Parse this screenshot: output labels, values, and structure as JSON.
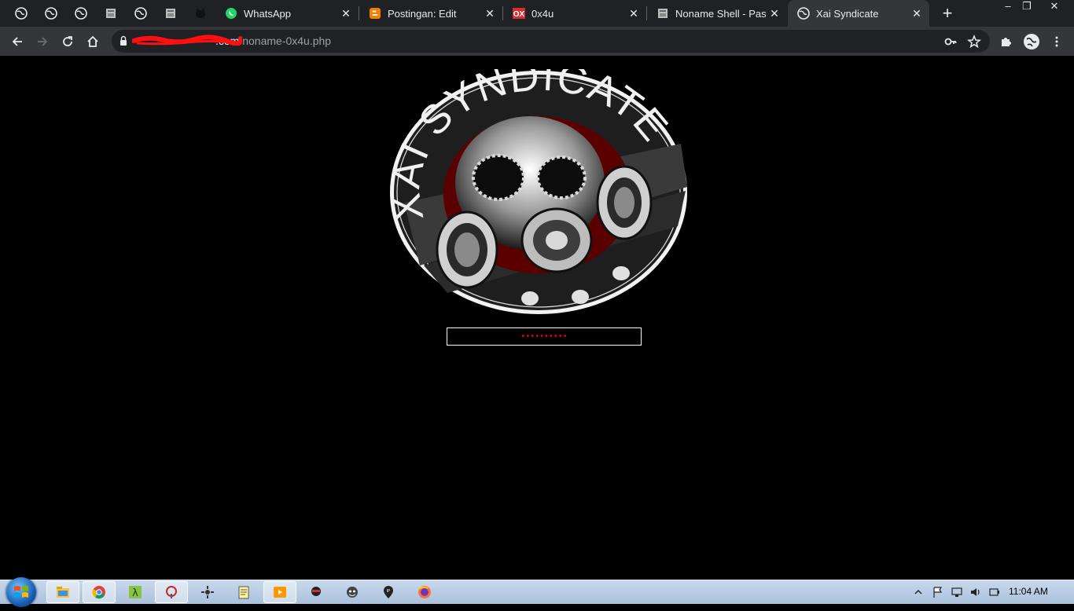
{
  "browser": {
    "pinned_tabs": [
      "globe-icon",
      "globe-icon",
      "globe-icon",
      "document-icon",
      "globe-icon",
      "document-icon",
      "cat-icon"
    ],
    "tabs": [
      {
        "title": "WhatsApp",
        "icon": "whatsapp-icon",
        "active": false
      },
      {
        "title": "Postingan: Edit",
        "icon": "blogger-icon",
        "active": false
      },
      {
        "title": "0x4u",
        "icon": "ox-icon",
        "active": false
      },
      {
        "title": "Noname Shell - Paste",
        "icon": "document-icon",
        "active": false
      },
      {
        "title": "Xai Syndicate",
        "icon": "globe-icon",
        "active": true
      }
    ],
    "close_glyph": "✕",
    "new_tab_glyph": "+",
    "window_controls": {
      "minimize": "–",
      "restore": "❐",
      "close": "✕"
    },
    "url": {
      "host_suffix": ".com",
      "path": "/noname-0x4u.php"
    }
  },
  "page": {
    "logo": {
      "alt": "XAI SYNDICATE",
      "text": "XAI SYNDICATE"
    },
    "password_value": "••••••••••"
  },
  "taskbar": {
    "clock": "11:04 AM",
    "apps": [
      "explorer-icon",
      "chrome-icon",
      "lambda-icon",
      "app-icon",
      "network-icon",
      "notepad-icon",
      "media-player-icon",
      "ninja-icon",
      "joker-icon",
      "ip-icon",
      "firefox-icon"
    ]
  },
  "colors": {
    "tab_bg": "#202124",
    "toolbar_bg": "#35363a",
    "logo_red": "#8b0000",
    "password_dots": "#e00000"
  }
}
